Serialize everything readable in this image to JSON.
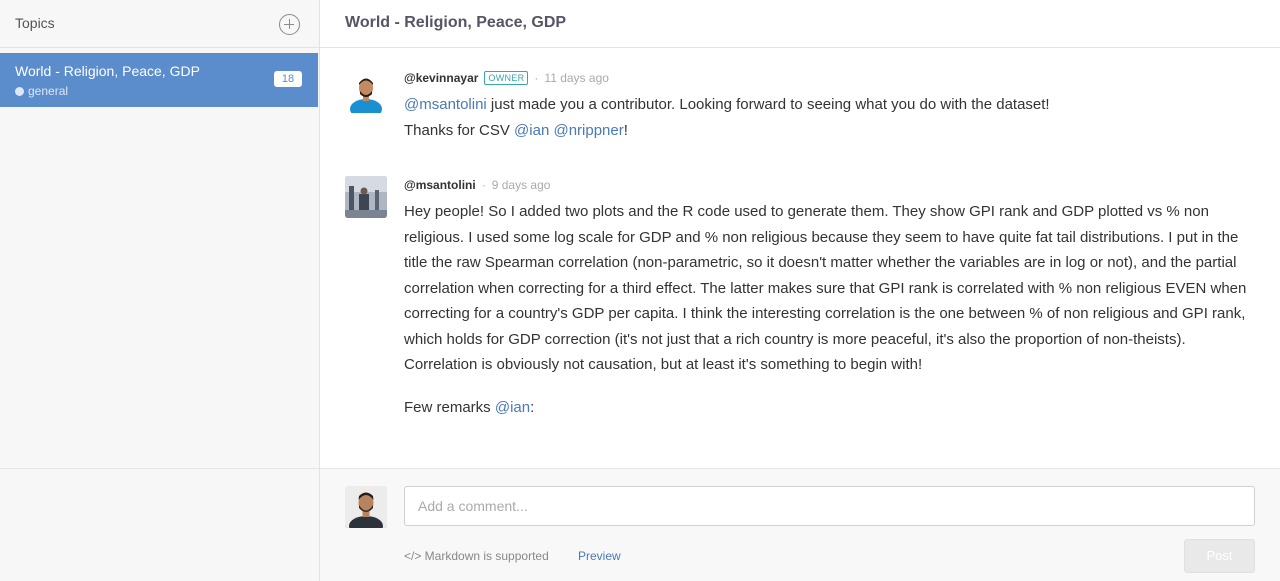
{
  "sidebar": {
    "title": "Topics",
    "topic": {
      "title": "World - Religion, Peace, GDP",
      "subtitle": "general",
      "count": "18"
    }
  },
  "main": {
    "title": "World - Religion, Peace, GDP"
  },
  "comments": [
    {
      "username": "@kevinnayar",
      "badge": "OWNER",
      "separator": "·",
      "time": "11 days ago",
      "line1_mention": "@msantolini",
      "line1_text": " just made you a contributor. Looking forward to seeing what you do with the dataset!",
      "line2_text": "Thanks for CSV ",
      "line2_mention1": "@ian",
      "line2_mention2": "@nrippner",
      "line2_end": "!"
    },
    {
      "username": "@msantolini",
      "separator": "·",
      "time": "9 days ago",
      "paragraph1": "Hey people! So I added two plots and the R code used to generate them. They show GPI rank and GDP plotted vs % non religious. I used some log scale for GDP and % non religious because they seem to have quite fat tail distributions. I put in the title the raw Spearman correlation (non-parametric, so it doesn't matter whether the variables are in log or not), and the partial correlation when correcting for a third effect. The latter makes sure that GPI rank is correlated with % non religious EVEN when correcting for a country's GDP per capita. I think the interesting correlation is the one between % of non religious and GPI rank, which holds for GDP correction (it's not just that a rich country is more peaceful, it's also the proportion of non-theists). Correlation is obviously not causation, but at least it's something to begin with!",
      "paragraph2_text": "Few remarks ",
      "paragraph2_mention": "@ian",
      "paragraph2_end": ":"
    }
  ],
  "composer": {
    "placeholder": "Add a comment...",
    "markdown_note": "</> Markdown is supported",
    "preview_label": "Preview",
    "post_label": "Post"
  }
}
